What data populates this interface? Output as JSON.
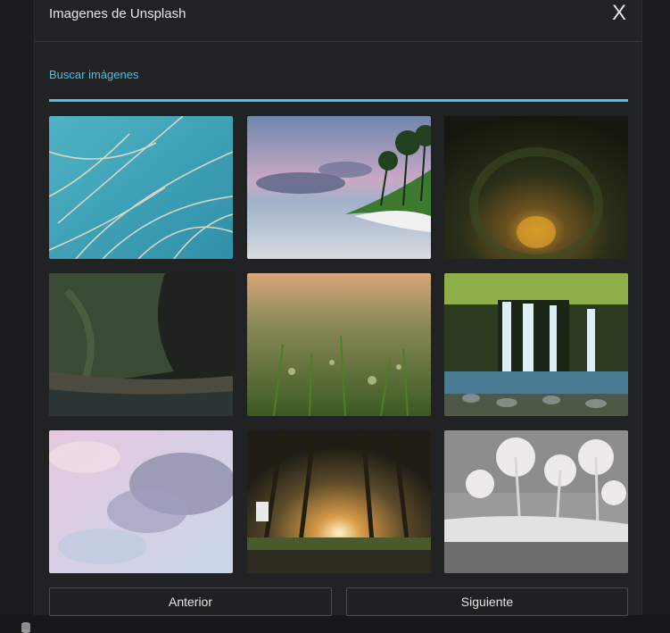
{
  "modal": {
    "title": "Imagenes de Unsplash",
    "close_label": "X"
  },
  "search": {
    "placeholder": "Buscar imágenes",
    "value": ""
  },
  "images": [
    {
      "name": "grass-sky-image"
    },
    {
      "name": "beach-palms-image"
    },
    {
      "name": "tree-tunnel-image"
    },
    {
      "name": "cave-stream-image"
    },
    {
      "name": "grass-bokeh-image"
    },
    {
      "name": "waterfall-image"
    },
    {
      "name": "pink-clouds-image"
    },
    {
      "name": "forest-road-image"
    },
    {
      "name": "infrared-palms-image"
    }
  ],
  "pagination": {
    "prev_label": "Anterior",
    "next_label": "Siguiente"
  },
  "colors": {
    "accent": "#4fc1e2",
    "background": "#212223",
    "text": "#e8e8e8"
  }
}
